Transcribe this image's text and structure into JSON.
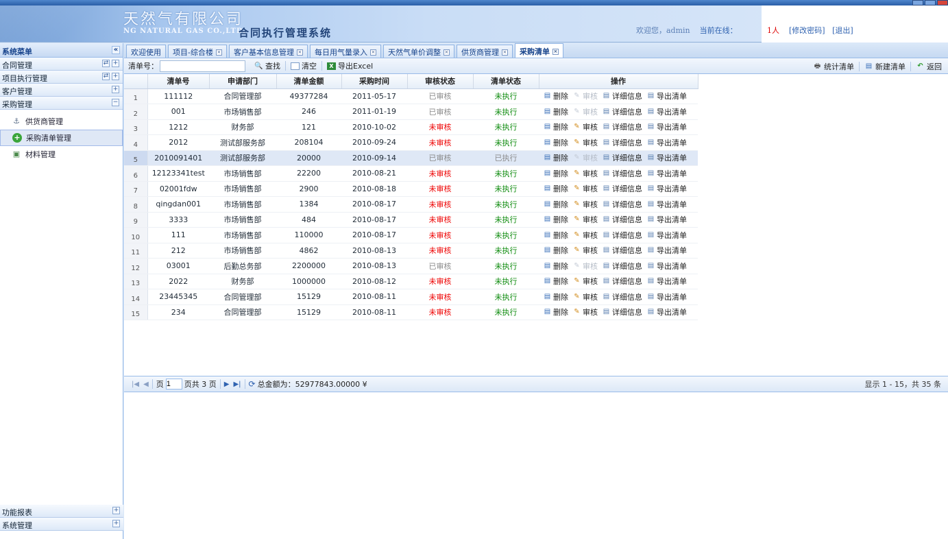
{
  "header": {
    "logo_cn": "天然气有限公司",
    "logo_en": "NG NATURAL GAS CO.,LTD.",
    "system_title": "合同执行管理系统",
    "welcome": "欢迎您，admin",
    "online_label": "当前在线：",
    "online_count": "1人",
    "change_pwd": "[修改密码]",
    "logout": "[退出]"
  },
  "sidebar": {
    "title": "系统菜单",
    "collapse": "«",
    "groups_top": [
      {
        "label": "合同管理"
      },
      {
        "label": "项目执行管理"
      },
      {
        "label": "客户管理"
      },
      {
        "label": "采购管理"
      }
    ],
    "items": [
      {
        "label": "供货商管理",
        "icon": "anchor-icon"
      },
      {
        "label": "采购清单管理",
        "icon": "add-circle-icon"
      },
      {
        "label": "材料管理",
        "icon": "box-icon"
      }
    ],
    "groups_bottom": [
      {
        "label": "功能报表"
      },
      {
        "label": "系统管理"
      }
    ]
  },
  "tabs": [
    {
      "label": "欢迎使用"
    },
    {
      "label": "项目-综合楼"
    },
    {
      "label": "客户基本信息管理"
    },
    {
      "label": "每日用气量录入"
    },
    {
      "label": "天然气单价调整"
    },
    {
      "label": "供货商管理"
    },
    {
      "label": "采购清单"
    }
  ],
  "toolbar": {
    "order_label": "清单号：",
    "search_placeholder": "",
    "find": "查找",
    "clear": "清空",
    "export": "导出Excel",
    "stats": "统计清单",
    "new": "新建清单",
    "back": "返回"
  },
  "columns": [
    "清单号",
    "申请部门",
    "清单金额",
    "采购时间",
    "审核状态",
    "清单状态",
    "操作"
  ],
  "actions": {
    "delete": "删除",
    "audit": "审核",
    "detail": "详细信息",
    "export": "导出清单"
  },
  "rows": [
    {
      "n": "1",
      "id": "111112",
      "dept": "合同管理部",
      "amount": "49377284",
      "date": "2011-05-17",
      "audit": "已审核",
      "state": "未执行"
    },
    {
      "n": "2",
      "id": "001",
      "dept": "市场销售部",
      "amount": "246",
      "date": "2011-01-19",
      "audit": "已审核",
      "state": "未执行"
    },
    {
      "n": "3",
      "id": "1212",
      "dept": "财务部",
      "amount": "121",
      "date": "2010-10-02",
      "audit": "未审核",
      "state": "未执行"
    },
    {
      "n": "4",
      "id": "2012",
      "dept": "测试部服务部",
      "amount": "208104",
      "date": "2010-09-24",
      "audit": "未审核",
      "state": "未执行"
    },
    {
      "n": "5",
      "id": "2010091401",
      "dept": "测试部服务部",
      "amount": "20000",
      "date": "2010-09-14",
      "audit": "已审核",
      "state": "已执行"
    },
    {
      "n": "6",
      "id": "12123341test",
      "dept": "市场销售部",
      "amount": "22200",
      "date": "2010-08-21",
      "audit": "未审核",
      "state": "未执行"
    },
    {
      "n": "7",
      "id": "02001fdw",
      "dept": "市场销售部",
      "amount": "2900",
      "date": "2010-08-18",
      "audit": "未审核",
      "state": "未执行"
    },
    {
      "n": "8",
      "id": "qingdan001",
      "dept": "市场销售部",
      "amount": "1384",
      "date": "2010-08-17",
      "audit": "未审核",
      "state": "未执行"
    },
    {
      "n": "9",
      "id": "3333",
      "dept": "市场销售部",
      "amount": "484",
      "date": "2010-08-17",
      "audit": "未审核",
      "state": "未执行"
    },
    {
      "n": "10",
      "id": "111",
      "dept": "市场销售部",
      "amount": "110000",
      "date": "2010-08-17",
      "audit": "未审核",
      "state": "未执行"
    },
    {
      "n": "11",
      "id": "212",
      "dept": "市场销售部",
      "amount": "4862",
      "date": "2010-08-13",
      "audit": "未审核",
      "state": "未执行"
    },
    {
      "n": "12",
      "id": "03001",
      "dept": "后勤总务部",
      "amount": "2200000",
      "date": "2010-08-13",
      "audit": "已审核",
      "state": "未执行"
    },
    {
      "n": "13",
      "id": "2022",
      "dept": "财务部",
      "amount": "1000000",
      "date": "2010-08-12",
      "audit": "未审核",
      "state": "未执行"
    },
    {
      "n": "14",
      "id": "23445345",
      "dept": "合同管理部",
      "amount": "15129",
      "date": "2010-08-11",
      "audit": "未审核",
      "state": "未执行"
    },
    {
      "n": "15",
      "id": "234",
      "dept": "合同管理部",
      "amount": "15129",
      "date": "2010-08-11",
      "audit": "未审核",
      "state": "未执行"
    }
  ],
  "selected_row": 5,
  "pager": {
    "page_label": "页",
    "page_value": "1",
    "of_label": "页共 3 页",
    "total": "总金额为：52977843.00000 ¥",
    "info": "显示 1 - 15，共 35 条"
  },
  "colors": {
    "accent": "#15428b",
    "pending": "#e00000",
    "done": "#8a8a8a",
    "state_green": "#0b8a0b",
    "selected": "#dfe8f6"
  }
}
